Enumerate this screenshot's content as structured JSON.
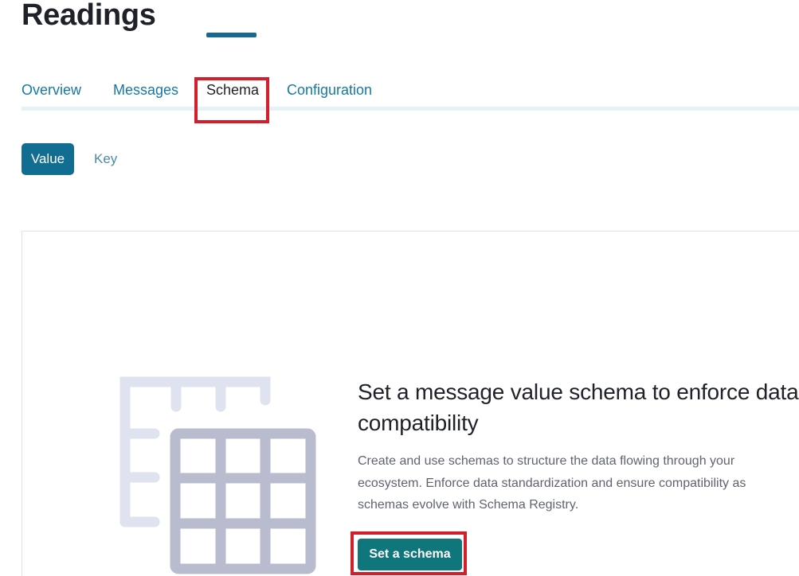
{
  "header": {
    "title": "Readings"
  },
  "tabs": [
    {
      "label": "Overview",
      "active": false
    },
    {
      "label": "Messages",
      "active": false
    },
    {
      "label": "Schema",
      "active": true
    },
    {
      "label": "Configuration",
      "active": false
    }
  ],
  "schema_type_toggle": {
    "options": [
      "Value",
      "Key"
    ],
    "selected": "Value"
  },
  "empty_state": {
    "heading": "Set a message value schema to enforce data compatibility",
    "description": "Create and use schemas to structure the data flowing through your ecosystem. Enforce data standardization and ensure compatibility as schemas evolve with Schema Registry.",
    "button_label": "Set a schema",
    "illustration_icon": "table-grid-icon"
  },
  "colors": {
    "accent": "#116d91",
    "tab_link": "#1679a4",
    "cta": "#0f777c",
    "highlight": "#d31f2b",
    "illustration_back": "#dfe3ef",
    "illustration_front": "#b9bccf"
  }
}
